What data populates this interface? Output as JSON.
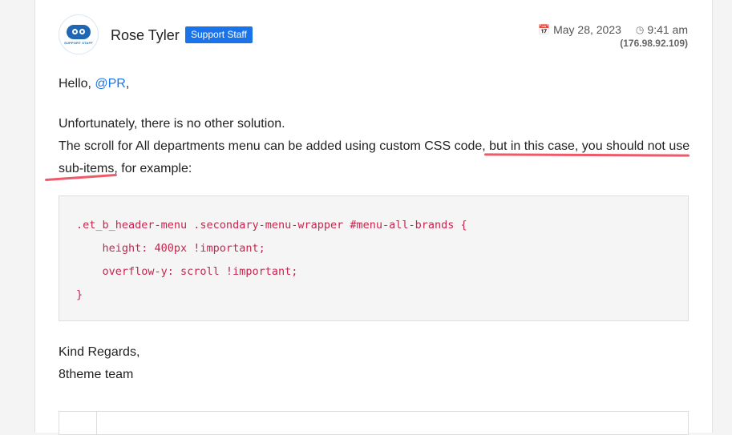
{
  "post": {
    "author": "Rose Tyler",
    "badge": "Support Staff",
    "avatar_text": "SUPPORT STAFF",
    "date": "May 28, 2023",
    "time": "9:41 am",
    "ip": "(176.98.92.109)"
  },
  "message": {
    "greeting_prefix": "Hello, ",
    "mention": "@PR",
    "greeting_suffix": ",",
    "line1": "Unfortunately, there is no other solution.",
    "line2_start": "The scroll for All departments menu can be added using custom CSS code,",
    "line2_highlight": " but in this case, you should not use",
    "line3_highlight": "sub-items",
    "line3_end": ", for example:"
  },
  "code": {
    "lines": [
      ".et_b_header-menu .secondary-menu-wrapper #menu-all-brands {",
      "    height: 400px !important;",
      "    overflow-y: scroll !important;",
      "}"
    ]
  },
  "signature": {
    "line1": "Kind Regards,",
    "line2": "8theme team"
  },
  "icons": {
    "date": "calendar-icon",
    "time": "clock-icon"
  },
  "colors": {
    "badge": "#1a73e8",
    "mention": "#1a73e8",
    "code_text": "#c7254e",
    "annotation": "#ef5a6b"
  }
}
